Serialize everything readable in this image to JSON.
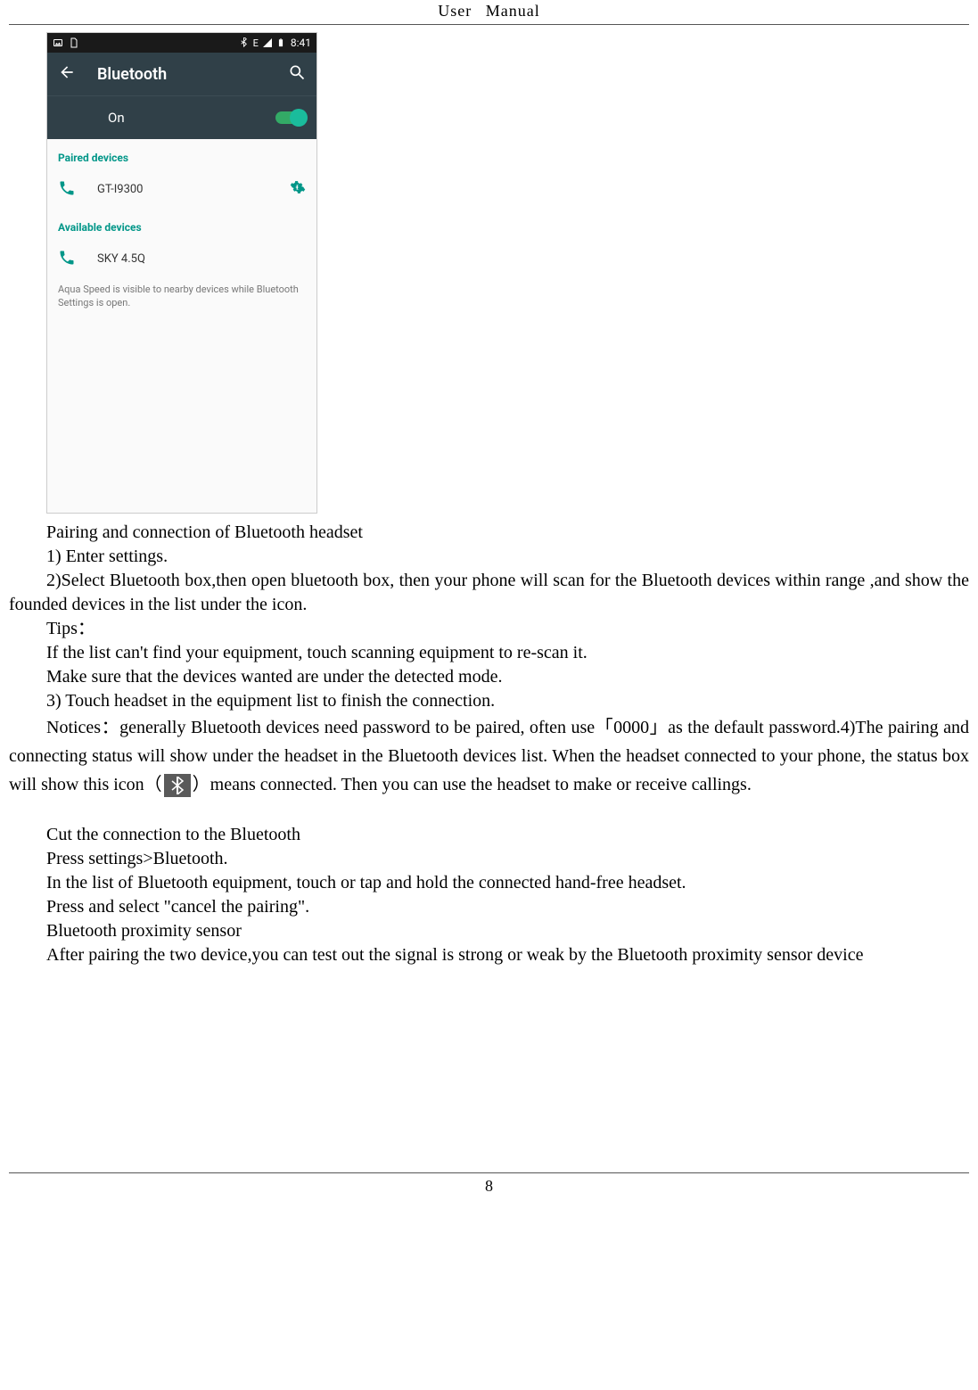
{
  "header": {
    "left": "User",
    "right": "Manual"
  },
  "statusbar": {
    "time": "8:41",
    "net": "E"
  },
  "appbar": {
    "title": "Bluetooth"
  },
  "onrow": {
    "label": "On"
  },
  "sections": {
    "paired": "Paired devices",
    "available": "Available devices"
  },
  "devices": {
    "paired1": "GT-I9300",
    "avail1": "SKY 4.5Q"
  },
  "visibility": "Aqua Speed is visible to nearby devices while Bluetooth Settings is open.",
  "text": {
    "p1": "Pairing and connection of Bluetooth headset",
    "p2": "1) Enter settings.",
    "p3": "2)Select Bluetooth box,then open bluetooth box, then your phone will scan for the Bluetooth devices within range ,and show the founded devices in the list under the icon.",
    "p4": "Tips：",
    "p5": "If the list can't find your equipment, touch scanning equipment to re-scan it.",
    "p6": "Make sure that the devices wanted are under the detected mode.",
    "p7": "3) Touch headset in the equipment list to finish the connection.",
    "p8a": "Notices：generally Bluetooth devices need password to be paired, often use「0000」as the default password.4)The pairing and connecting status will show under the headset in the Bluetooth devices list. When the headset connected to your phone, the status box will show this icon（",
    "p8b": "）means connected. Then you can use the headset to make or receive callings.",
    "p9": "Cut the connection to the Bluetooth",
    "p10": "Press settings>Bluetooth.",
    "p11": "In the list of Bluetooth equipment, touch or tap and hold the connected hand-free headset.",
    "p12": "Press and select \"cancel the pairing\".",
    "p13": "Bluetooth proximity sensor",
    "p14": "After pairing the two device,you can test out the signal is strong or weak by the Bluetooth proximity sensor device"
  },
  "footer": {
    "page": "8"
  }
}
